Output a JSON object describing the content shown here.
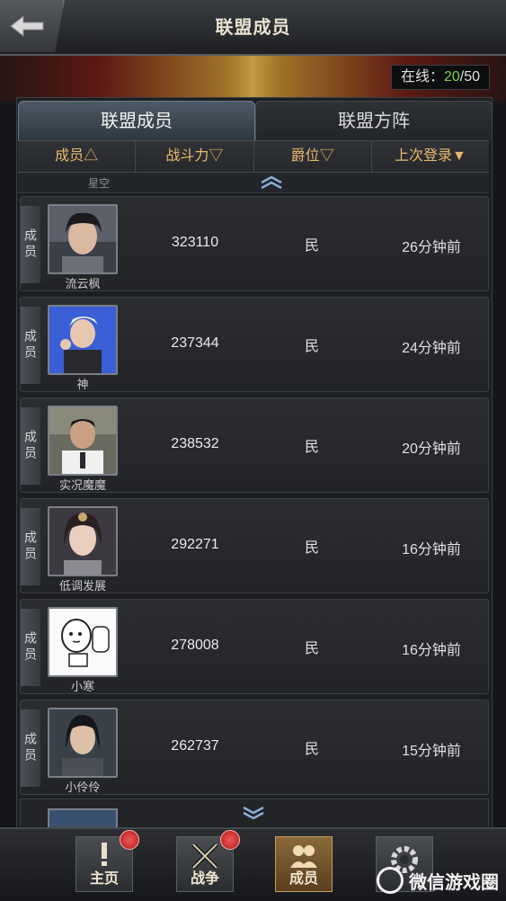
{
  "header": {
    "title": "联盟成员",
    "back_icon": "back-arrow-icon"
  },
  "online": {
    "label": "在线：",
    "count": "20",
    "sep": "/",
    "max": "50"
  },
  "tabs": [
    {
      "label": "联盟成员",
      "active": true
    },
    {
      "label": "联盟方阵",
      "active": false
    }
  ],
  "columns": [
    "成员△",
    "战斗力▽",
    "爵位▽",
    "上次登录▼"
  ],
  "prev_member": "星空",
  "rows": [
    {
      "rank": "成员",
      "name": "流云枫",
      "power": "323110",
      "title": "民",
      "last_login": "26分钟前"
    },
    {
      "rank": "成员",
      "name": "神",
      "power": "237344",
      "title": "民",
      "last_login": "24分钟前"
    },
    {
      "rank": "成员",
      "name": "实况魔魔",
      "power": "238532",
      "title": "民",
      "last_login": "20分钟前"
    },
    {
      "rank": "成员",
      "name": "低调发展",
      "power": "292271",
      "title": "民",
      "last_login": "16分钟前"
    },
    {
      "rank": "成员",
      "name": "小寒",
      "power": "278008",
      "title": "民",
      "last_login": "16分钟前"
    },
    {
      "rank": "成员",
      "name": "小伶伶",
      "power": "262737",
      "title": "民",
      "last_login": "15分钟前"
    }
  ],
  "nav": [
    {
      "label": "主页",
      "badge": true
    },
    {
      "label": "战争",
      "badge": true
    },
    {
      "label": "成员",
      "badge": false,
      "active": true
    },
    {
      "label": "",
      "badge": false
    }
  ],
  "watermark": "微信游戏圈",
  "colors": {
    "online_green": "#7fd04a",
    "header_gold": "#e9b86a"
  }
}
